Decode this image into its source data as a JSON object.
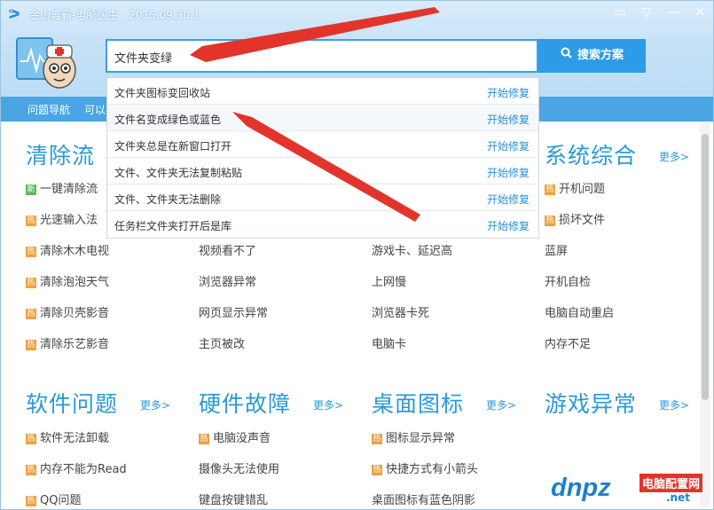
{
  "window": {
    "app_name": "金山毒霸-电脑医生",
    "version": "2015.09.30.1"
  },
  "search": {
    "value": "文件夹变绿",
    "button_label": "搜索方案"
  },
  "nav": {
    "item1": "问题导航",
    "item2": "可以"
  },
  "dropdown": {
    "items": [
      {
        "text": "文件夹图标变回收站",
        "action": "开始修复"
      },
      {
        "text": "文件名变成绿色或蓝色",
        "action": "开始修复"
      },
      {
        "text": "文件夹总是在新窗口打开",
        "action": "开始修复"
      },
      {
        "text": "文件、文件夹无法复制粘贴",
        "action": "开始修复"
      },
      {
        "text": "文件、文件夹无法删除",
        "action": "开始修复"
      },
      {
        "text": "任务栏文件夹打开后是库",
        "action": "开始修复"
      }
    ]
  },
  "sections": {
    "clean": {
      "title": "清除流",
      "items": [
        "一键清除流",
        "光速输入法",
        "清除木木电视",
        "清除泡泡天气",
        "清除贝壳影音",
        "清除乐艺影音"
      ]
    },
    "col2": {
      "items": [
        "视频看不了",
        "浏览器异常",
        "网页显示异常",
        "主页被改"
      ]
    },
    "col3": {
      "items": [
        "游戏卡、延迟高",
        "上网慢",
        "浏览器卡死",
        "电脑卡"
      ]
    },
    "system": {
      "title": "系统综合",
      "more": "更多>",
      "items": [
        "开机问题",
        "损坏文件",
        "蓝屏",
        "开机自检",
        "电脑自动重启",
        "内存不足"
      ]
    },
    "software": {
      "title": "软件问题",
      "more": "更多>",
      "items": [
        "软件无法卸载",
        "内存不能为Read",
        "QQ问题"
      ]
    },
    "hardware": {
      "title": "硬件故障",
      "more": "更多>",
      "items": [
        "电脑没声音",
        "摄像头无法使用",
        "键盘按键错乱"
      ]
    },
    "desktop": {
      "title": "桌面图标",
      "more": "更多>",
      "items": [
        "图标显示异常",
        "快捷方式有小箭头",
        "桌面图标有蓝色阴影"
      ]
    },
    "game": {
      "title": "游戏异常",
      "more": "更多>"
    }
  },
  "badges": {
    "hot": "热",
    "new": "新"
  },
  "watermark": {
    "main": "dnpz",
    "sub": "电脑配置网",
    "net": ".net"
  },
  "colors": {
    "accent": "#2a9ad8",
    "arrow": "#e2342b",
    "hot_badge": "#f0a040"
  }
}
